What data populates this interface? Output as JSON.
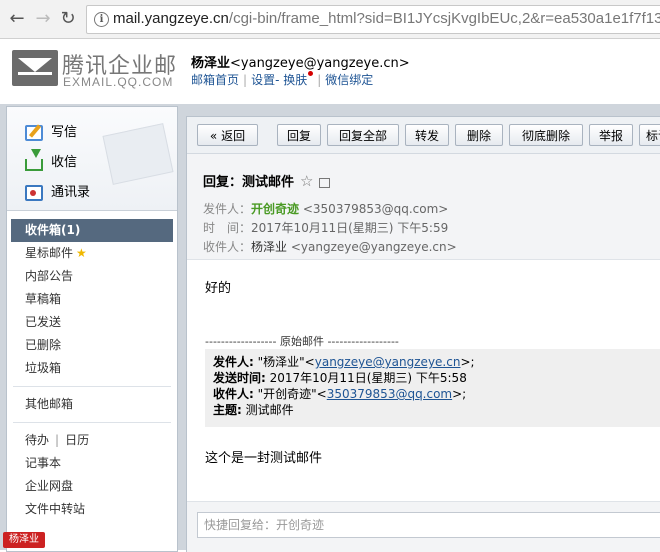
{
  "browser": {
    "url_host": "mail.yangzeye.cn",
    "url_path": "/cgi-bin/frame_html?sid=BI1JYcsjKvgIbEUc,2&r=ea530a1e1f7f13"
  },
  "logo": {
    "cn": "腾讯企业邮",
    "en": "EXMAIL.QQ.COM"
  },
  "user": {
    "name": "杨泽业",
    "email": "<yangzeye@yangzeye.cn>"
  },
  "header_links": {
    "home": "邮箱首页",
    "settings": "设置",
    "skin_prefix": "- ",
    "skin": "换肤",
    "wechat": "微信绑定",
    "sep": "|"
  },
  "sidebar": {
    "quick": {
      "write": "写信",
      "receive": "收信",
      "contacts": "通讯录"
    },
    "folders": [
      "收件箱(1)",
      "星标邮件",
      "内部公告",
      "草稿箱",
      "已发送",
      "已删除",
      "垃圾箱"
    ],
    "other": "其他邮箱",
    "todo": "待办",
    "calendar": "日历",
    "todo_sep": "|",
    "notes": "记事本",
    "netdisk": "企业网盘",
    "transfer": "文件中转站"
  },
  "stamp_text": "杨泽业",
  "toolbar": {
    "back": "« 返回",
    "reply": "回复",
    "reply_all": "回复全部",
    "forward": "转发",
    "delete": "删除",
    "delete_perm": "彻底删除",
    "report": "举报",
    "mark": "标记"
  },
  "mail": {
    "subject": "回复：测试邮件",
    "sender_label": "发件人：",
    "sender_name": "开创奇迹",
    "sender_email": "<350379853@qq.com>",
    "time_label": "时　间：",
    "time": "2017年10月11日(星期三) 下午5:59",
    "to_label": "收件人：",
    "to_name": "杨泽业",
    "to_email": "<yangzeye@yangzeye.cn>",
    "body": "好的",
    "original_sep": "------------------ 原始邮件 ------------------",
    "quote": {
      "from_label": "发件人:",
      "from_pre": " \"杨泽业\"<",
      "from_email": "yangzeye@yangzeye.cn",
      "from_post": ">;",
      "time_label": "发送时间:",
      "time": " 2017年10月11日(星期三) 下午5:58",
      "to_label": "收件人:",
      "to_pre": " \"开创奇迹\"<",
      "to_email": "350379853@qq.com",
      "to_post": ">;",
      "subject_label": "主题:",
      "subject": " 测试邮件"
    },
    "body2": "这个是一封测试邮件"
  },
  "quick_reply_placeholder": "快捷回复给：开创奇迹"
}
